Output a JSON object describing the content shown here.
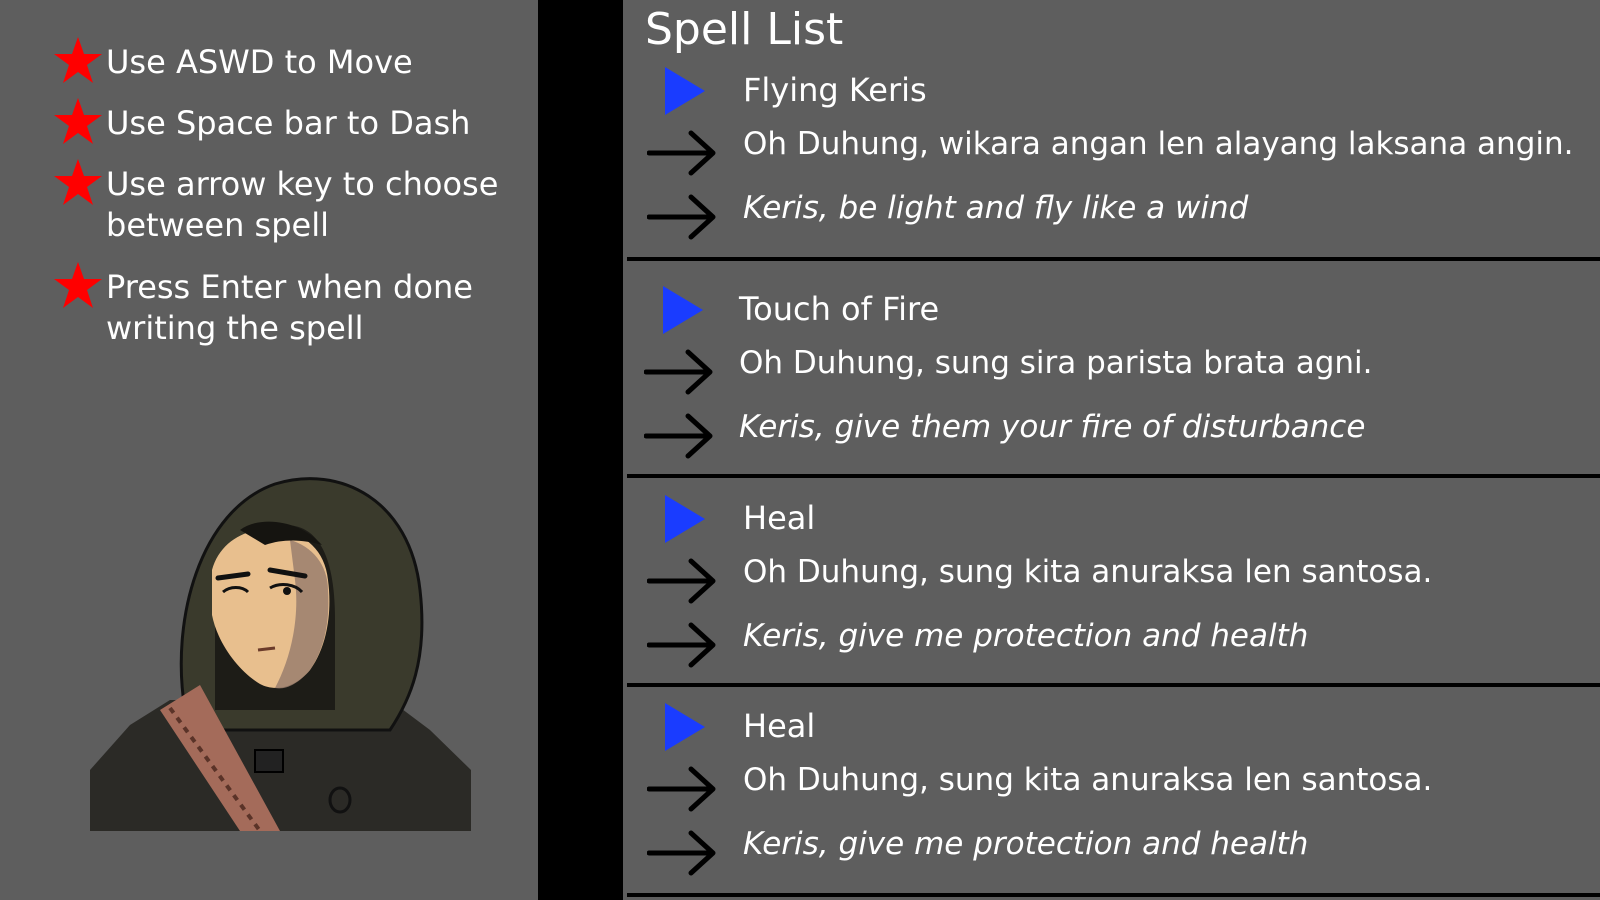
{
  "instructions": [
    {
      "text": "Use ASWD to Move",
      "icon": "star-icon"
    },
    {
      "text": "Use Space bar to Dash",
      "icon": "star-icon"
    },
    {
      "text": "Use arrow key to choose between spell",
      "icon": "star-icon"
    },
    {
      "text": "Press Enter when done writing the spell",
      "icon": "star-icon"
    }
  ],
  "spell_list": {
    "title": "Spell List",
    "spells": [
      {
        "name": "Flying Keris",
        "incantation": "Oh Duhung, wikara angan len alayang laksana angin.",
        "translation": "Keris, be light and fly like a wind"
      },
      {
        "name": "Touch of Fire",
        "incantation": "Oh Duhung, sung sira parista brata agni.",
        "translation": "Keris, give them your fire of disturbance"
      },
      {
        "name": "Heal",
        "incantation": "Oh Duhung, sung kita anuraksa len santosa.",
        "translation": "Keris, give me protection and health"
      },
      {
        "name": "Heal",
        "incantation": "Oh Duhung, sung kita anuraksa len santosa.",
        "translation": "Keris, give me protection and health"
      }
    ]
  },
  "colors": {
    "panel_background": "#5e5e5e",
    "frame_black": "#000000",
    "star_red": "#ff0000",
    "play_blue": "#1a3cff",
    "text_white": "#ffffff"
  },
  "icons": {
    "bullet": "star-icon",
    "spell_marker": "play-triangle-icon",
    "line_marker": "arrow-right-icon"
  }
}
